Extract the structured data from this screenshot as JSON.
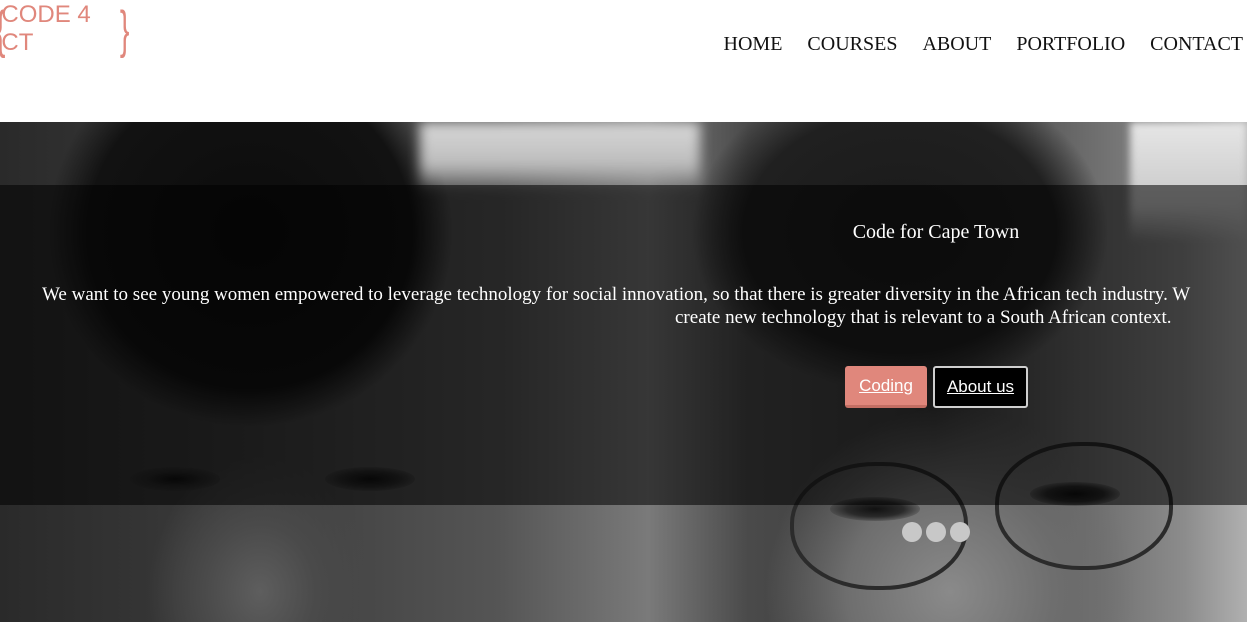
{
  "logo": {
    "text": "CODE 4 CT",
    "brace_open": "{",
    "brace_close": "}",
    "color": "#e0877c"
  },
  "nav": {
    "items": [
      "HOME",
      "COURSES",
      "ABOUT",
      "PORTFOLIO",
      "CONTACT"
    ]
  },
  "hero": {
    "title": "Code for Cape Town",
    "text_line1": "We want to see young women empowered to leverage technology for social innovation, so that there is greater diversity in the African tech industry. W",
    "text_line2": "create new technology that is relevant to a South African context.",
    "primary_button": "Coding",
    "secondary_button": "About us",
    "slide_count": 3,
    "accent_color": "#e0877c"
  }
}
